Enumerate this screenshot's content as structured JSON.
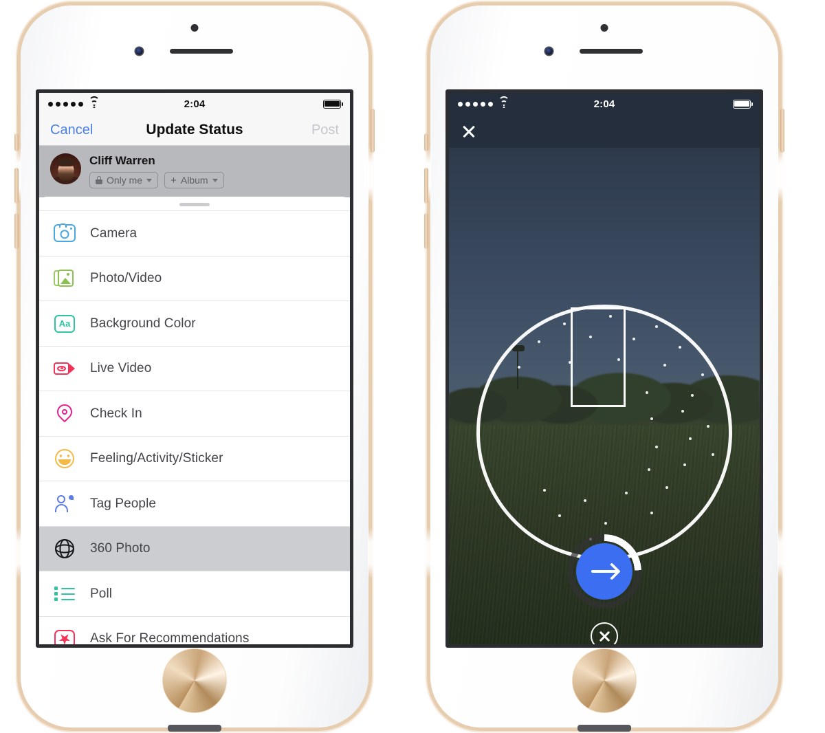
{
  "colors": {
    "accent_blue": "#4a7fe8",
    "shutter_blue": "#3b6ef0",
    "selected_row_bg": "#cbcdd1",
    "composer_bg": "#b8b9bd",
    "dark_navbar": "#242e3d",
    "disabled_gray": "#c6c7cc"
  },
  "left_phone": {
    "status_bar": {
      "signal": "•••••",
      "wifi": "wifi-icon",
      "time": "2:04",
      "battery": "battery-full-icon"
    },
    "navbar": {
      "cancel_label": "Cancel",
      "title": "Update Status",
      "post_label": "Post"
    },
    "composer": {
      "avatar": "user-avatar",
      "name": "Cliff Warren",
      "privacy_chip": {
        "icon": "lock-icon",
        "label": "Only me",
        "caret": "chevron-down-icon"
      },
      "album_chip": {
        "icon": "plus-icon",
        "label": "Album",
        "caret": "chevron-down-icon"
      }
    },
    "sheet": {
      "grabber": "drag-handle",
      "items": [
        {
          "label": "Camera",
          "icon": "camera-icon",
          "selected": false
        },
        {
          "label": "Photo/Video",
          "icon": "photo-video-icon",
          "selected": false
        },
        {
          "label": "Background Color",
          "icon": "background-color-icon",
          "selected": false
        },
        {
          "label": "Live Video",
          "icon": "live-video-icon",
          "selected": false
        },
        {
          "label": "Check In",
          "icon": "location-pin-icon",
          "selected": false
        },
        {
          "label": "Feeling/Activity/Sticker",
          "icon": "smiley-icon",
          "selected": false
        },
        {
          "label": "Tag People",
          "icon": "tag-people-icon",
          "selected": false
        },
        {
          "label": "360 Photo",
          "icon": "360-sphere-icon",
          "selected": true
        },
        {
          "label": "Poll",
          "icon": "poll-icon",
          "selected": false
        },
        {
          "label": "Ask For Recommendations",
          "icon": "recommendations-icon",
          "selected": false
        }
      ]
    }
  },
  "right_phone": {
    "status_bar": {
      "signal": "•••••",
      "wifi": "wifi-icon",
      "time": "2:04",
      "battery": "battery-full-icon"
    },
    "navbar": {
      "close": "close-icon"
    },
    "capture": {
      "sphere_guide": "360-capture-sphere",
      "viewfinder": "viewfinder-rect",
      "tracking_dots": "tracking-points",
      "captured_band": "captured-panorama-band",
      "uncaptured_overlay": "uncaptured-region",
      "shutter": {
        "icon": "arrow-right-icon",
        "progress_percent": 24
      },
      "cancel": "cancel-capture-icon"
    }
  }
}
